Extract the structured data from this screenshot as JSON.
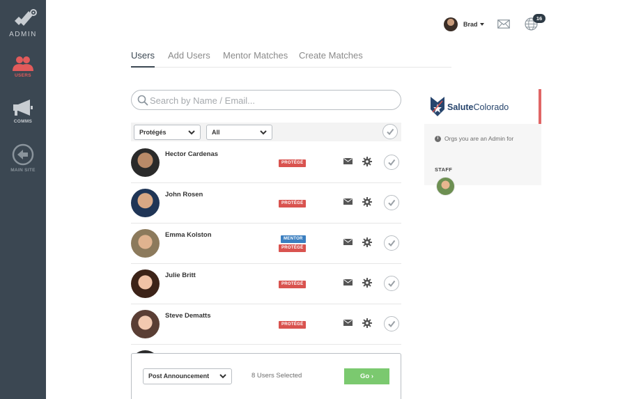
{
  "sidebar": {
    "brand_label": "ADMIN",
    "items": [
      {
        "label": "USERS",
        "icon": "users-icon",
        "state": "active"
      },
      {
        "label": "COMMS",
        "icon": "megaphone-icon",
        "state": "normal"
      },
      {
        "label": "MAIN SITE",
        "icon": "back-arrow-icon",
        "state": "dim"
      }
    ]
  },
  "header": {
    "user_name": "Brad",
    "notification_count": "16"
  },
  "tabs": [
    {
      "label": "Users",
      "active": true
    },
    {
      "label": "Add Users",
      "active": false
    },
    {
      "label": "Mentor Matches",
      "active": false
    },
    {
      "label": "Create Matches",
      "active": false
    }
  ],
  "search": {
    "placeholder": "Search by Name / Email...",
    "value": ""
  },
  "filters": {
    "role_selected": "Protégés",
    "status_selected": "All"
  },
  "users": [
    {
      "name": "Hector Cardenas",
      "badges": [
        "PROTÉGÉ"
      ]
    },
    {
      "name": "John Rosen",
      "badges": [
        "PROTÉGÉ"
      ]
    },
    {
      "name": "Emma Kolston",
      "badges": [
        "MENTOR",
        "PROTÉGÉ"
      ]
    },
    {
      "name": "Julie Britt",
      "badges": [
        "PROTÉGÉ"
      ]
    },
    {
      "name": "Steve Dematts",
      "badges": [
        "PROTÉGÉ"
      ]
    }
  ],
  "action_bar": {
    "action_selected": "Post Announcement",
    "selected_count_text": "8 Users Selected",
    "go_label": "Go ›"
  },
  "org_panel": {
    "org_name_bold": "Salute",
    "org_name_rest": "Colorado",
    "info_text": "Orgs you are an Admin for",
    "staff_label": "STAFF"
  },
  "colors": {
    "sidebar_bg": "#3b4752",
    "active_red": "#e25b5b",
    "protege_badge": "#d9534f",
    "mentor_badge": "#3b7fc0",
    "go_button": "#7bc96f",
    "org_accent": "#e06666"
  }
}
